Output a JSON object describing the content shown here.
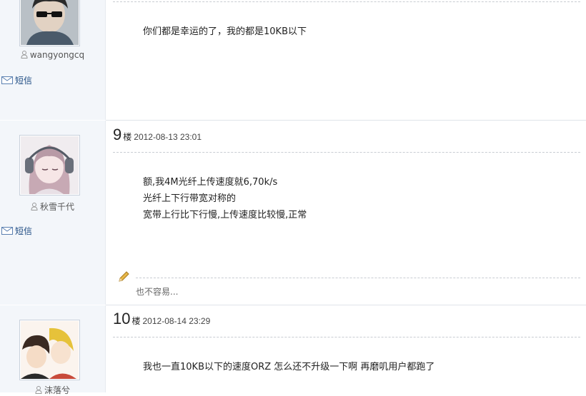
{
  "posts": [
    {
      "username": "wangyongcq",
      "sms_label": "短信",
      "content_lines": [
        "你们都是幸运的了，我的都是10KB以下"
      ]
    },
    {
      "floor_number": "9",
      "floor_unit": "楼",
      "timestamp": "2012-08-13 23:01",
      "username": "秋雪千代",
      "sms_label": "短信",
      "content_lines": [
        "额,我4M光纤上传速度就6,70k/s",
        "光纤上下行带宽对称的",
        "宽带上行比下行慢,上传速度比较慢,正常"
      ],
      "signature": "也不容易..."
    },
    {
      "floor_number": "10",
      "floor_unit": "楼",
      "timestamp": "2012-08-14 23:29",
      "username": "沫落兮",
      "content_lines": [
        "我也一直10KB以下的速度ORZ 怎么还不升级一下啊 再磨叽用户都跑了"
      ]
    }
  ],
  "icons": {
    "user": "user-icon",
    "envelope": "envelope-icon",
    "edit": "pencil-icon"
  },
  "colors": {
    "sidebar_bg": "#f3f6fa",
    "link": "#1e4b82"
  }
}
